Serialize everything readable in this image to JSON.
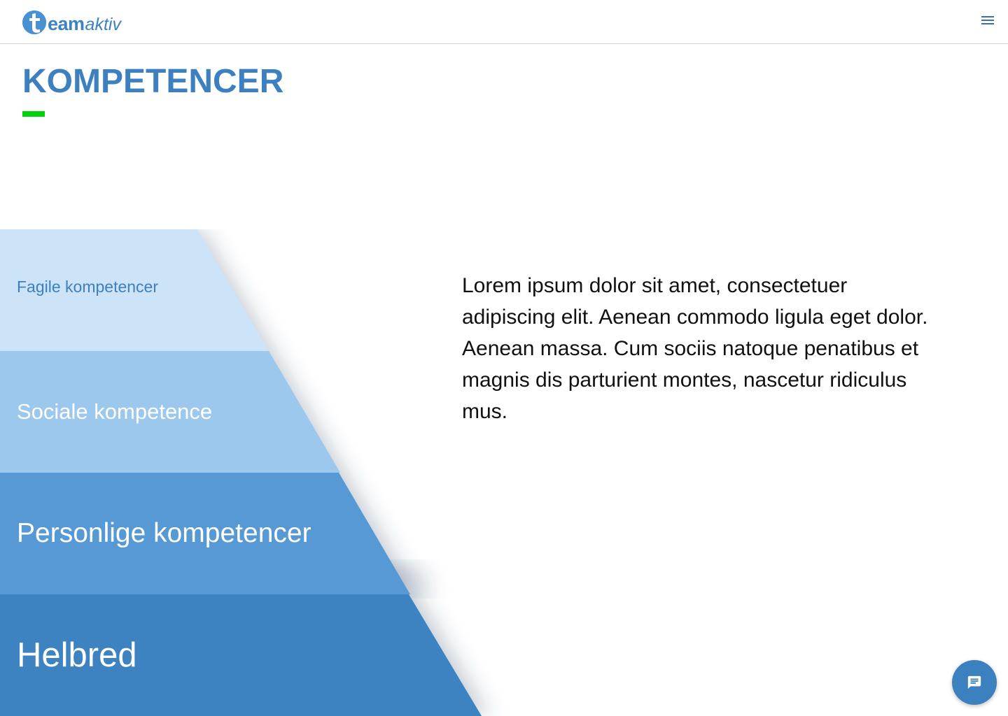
{
  "header": {
    "logo": {
      "letter": "t",
      "team": "eam",
      "aktiv": "aktiv"
    },
    "menu_icon": "hamburger-menu-icon"
  },
  "main": {
    "title": "KOMPETENCER",
    "accent_color": "#00d30a",
    "pyramid": [
      {
        "label": "Fagile kompetencer",
        "color": "#cde4f8"
      },
      {
        "label": "Sociale kompetence",
        "color": "#9bc8ec"
      },
      {
        "label": "Personlige kompetencer",
        "color": "#5699d5"
      },
      {
        "label": "Helbred",
        "color": "#3d83c1"
      }
    ],
    "description": "Lorem ipsum dolor sit amet, consectetuer adipiscing elit. Aenean commodo ligula eget dolor. Aenean massa. Cum sociis natoque penatibus et magnis dis parturient montes, nascetur ridiculus mus."
  },
  "chat": {
    "icon": "chat-message-icon",
    "color": "#3d80c0"
  },
  "colors": {
    "brand": "#3d80c0",
    "accent": "#00d30a"
  }
}
